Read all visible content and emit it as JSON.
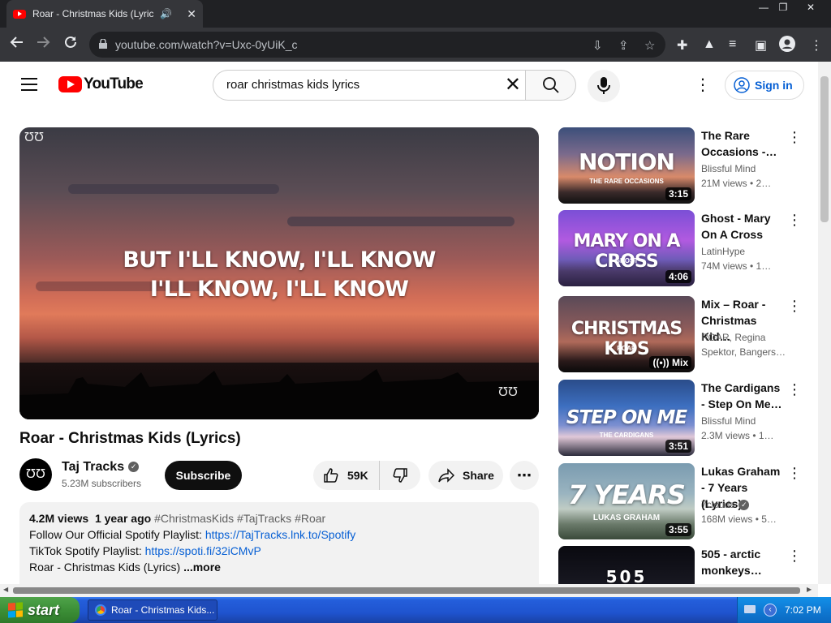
{
  "browser": {
    "tab_title": "Roar - Christmas Kids (Lyrics) -",
    "url": "youtube.com/watch?v=Uxc-0yUiK_c",
    "minimize": "—",
    "restore": "❐",
    "close": "✕"
  },
  "header": {
    "logo_text": "YouTube",
    "search_value": "roar christmas kids lyrics",
    "sign_in": "Sign in"
  },
  "video": {
    "lyric_line_1": "BUT I'LL KNOW, I'LL KNOW",
    "lyric_line_2": "I'LL KNOW, I'LL KNOW",
    "watermark": "ƱƱ",
    "title": "Roar - Christmas Kids (Lyrics)",
    "channel": "Taj Tracks",
    "subscribers": "5.23M subscribers",
    "subscribe_label": "Subscribe",
    "likes": "59K",
    "share_label": "Share"
  },
  "description": {
    "views": "4.2M views",
    "age": "1 year ago",
    "tags": "#ChristmasKids #TajTracks #Roar",
    "line2_text": "Follow Our Official Spotify Playlist: ",
    "line2_link": "https://TajTracks.lnk.to/Spotify",
    "line3_text": "TikTok Spotify Playlist: ",
    "line3_link": "https://spoti.fi/32iCMvP",
    "line4_text": "Roar - Christmas Kids (Lyrics)",
    "more": "...more"
  },
  "recommendations": [
    {
      "thumb_text": "NOTION",
      "thumb_sub": "THE RARE OCCASIONS",
      "duration": "3:15",
      "title": "The Rare Occasions -…",
      "channel": "Blissful Mind",
      "views": "21M views • 2…"
    },
    {
      "thumb_text": "MARY ON A CROSS",
      "thumb_sub": "GHOST",
      "duration": "4:06",
      "title": "Ghost - Mary On A Cross",
      "channel": "LatinHype",
      "views": "74M views • 1…"
    },
    {
      "thumb_text": "CHRISTMAS KIDS",
      "thumb_sub": "ROAR",
      "duration": "Mix",
      "title": "Mix – Roar - Christmas Kid…",
      "channel": "ROAR, Regina",
      "channel2": "Spektor, Bangers…",
      "views": ""
    },
    {
      "thumb_text": "STEP ON ME",
      "thumb_sub": "THE CARDIGANS",
      "duration": "3:51",
      "title": "The Cardigans - Step On Me…",
      "channel": "Blissful Mind",
      "views": "2.3M views • 1…"
    },
    {
      "thumb_text": "7 YEARS",
      "thumb_sub": "LUKAS GRAHAM",
      "duration": "3:55",
      "title": "Lukas Graham - 7 Years (Lyrics)",
      "channel": "7clouds",
      "views": "168M views • 5…"
    },
    {
      "thumb_text": "505",
      "thumb_sub": "",
      "duration": "",
      "title": "505 - arctic monkeys…",
      "channel": "",
      "views": ""
    }
  ],
  "taskbar": {
    "start": "start",
    "window": "Roar - Christmas Kids...",
    "clock": "7:02 PM"
  },
  "icons": {
    "back": "arrow-left-icon",
    "forward": "arrow-right-icon",
    "reload": "reload-icon",
    "search": "search-icon",
    "mic": "microphone-icon",
    "like": "thumbs-up-icon",
    "dislike": "thumbs-down-icon",
    "share": "share-icon"
  },
  "colors": {
    "brand_red": "#ff0000",
    "link_blue": "#065fd4"
  }
}
